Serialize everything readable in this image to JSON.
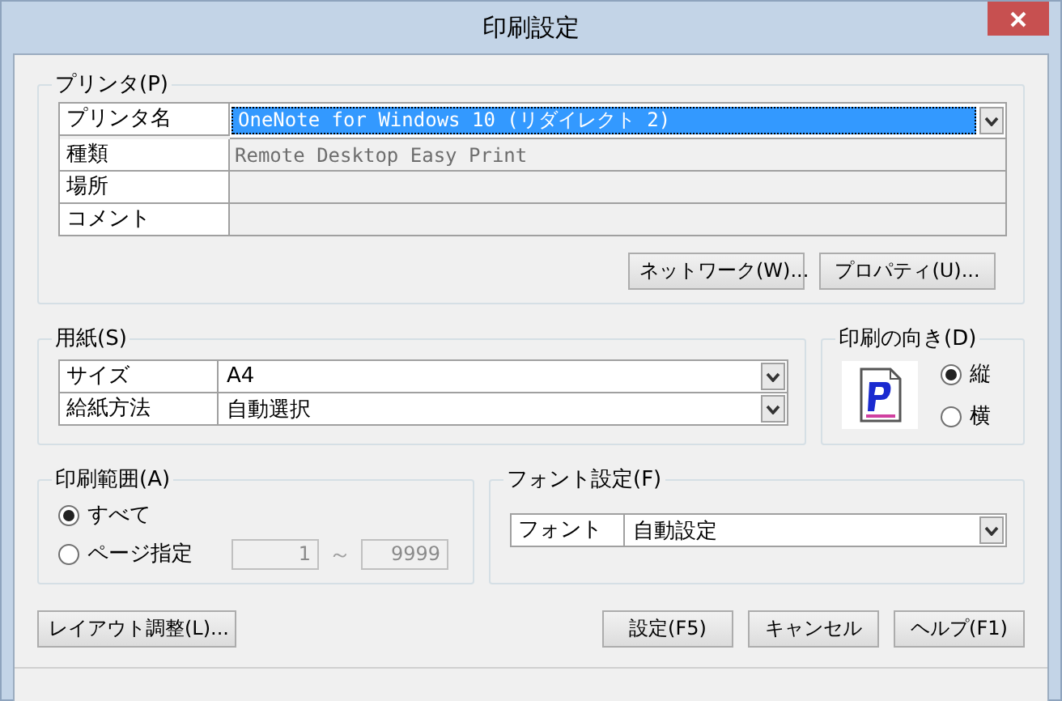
{
  "window": {
    "title": "印刷設定"
  },
  "printer_group": {
    "title": "プリンタ(P)",
    "rows": [
      {
        "label": "プリンタ名",
        "value": "OneNote for Windows 10 (リダイレクト 2)",
        "kind": "dropdown"
      },
      {
        "label": "種類",
        "value": "Remote Desktop Easy Print",
        "kind": "readonly"
      },
      {
        "label": "場所",
        "kind": "readonly"
      },
      {
        "label": "コメント",
        "kind": "readonly"
      }
    ],
    "buttons": [
      "ネットワーク(W)...",
      "プロパティ(U)..."
    ]
  },
  "paper_group": {
    "title": "用紙(S)",
    "rows": [
      {
        "label": "サイズ",
        "value": "A4"
      },
      {
        "label": "給紙方法",
        "value": "自動選択"
      }
    ]
  },
  "orientation_group": {
    "title": "印刷の向き(D)",
    "options": [
      {
        "label": "縦",
        "selected": true
      },
      {
        "label": "横",
        "selected": false
      }
    ]
  },
  "range_group": {
    "title": "印刷範囲(A)",
    "options": [
      {
        "label": "すべて",
        "selected": true
      },
      {
        "label": "ページ指定",
        "selected": false
      }
    ],
    "from": "1",
    "separator": "～",
    "to": "9999",
    "disabled": true
  },
  "font_group": {
    "title": "フォント設定(F)",
    "label": "フォント",
    "value": "自動設定"
  },
  "buttons": [
    "レイアウト調整(L)...",
    "設定(F5)",
    "キャンセル",
    "ヘルプ(F1)"
  ]
}
